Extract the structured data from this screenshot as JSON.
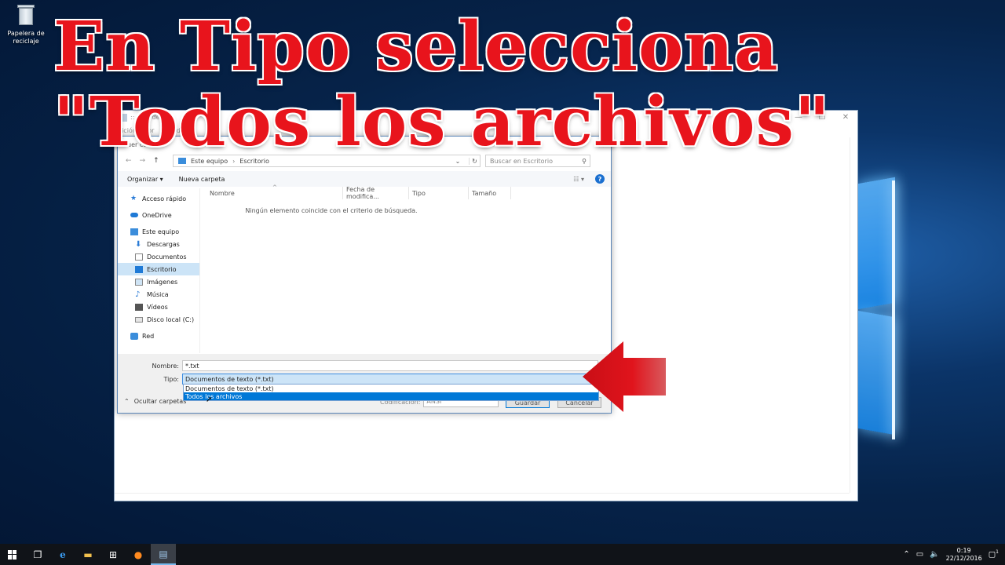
{
  "desktop": {
    "recycle_bin_label": "Papelera de reciclaje"
  },
  "caption": {
    "text": "En Tipo selecciona \"Todos los archivos\""
  },
  "notepad": {
    "title": ":: Bloc de",
    "menu": [
      "uición",
      "For",
      "er",
      "da"
    ],
    "minimize": "—",
    "maximize": "☐",
    "close": "✕"
  },
  "dialog": {
    "title": "uer como",
    "close": "✕",
    "address": {
      "root": "Este equipo",
      "current": "Escritorio"
    },
    "search_placeholder": "Buscar en Escritorio",
    "toolbar": {
      "organize": "Organizar ▾",
      "new_folder": "Nueva carpeta",
      "view": "☷ ▾",
      "help": "?"
    },
    "nav": [
      {
        "label": "Acceso rápido",
        "icon": "star-icon",
        "sub": false
      },
      {
        "label": "OneDrive",
        "icon": "cloud-icon",
        "sub": false
      },
      {
        "label": "Este equipo",
        "icon": "computer-icon",
        "sub": false
      },
      {
        "label": "Descargas",
        "icon": "download-icon",
        "sub": true
      },
      {
        "label": "Documentos",
        "icon": "document-icon",
        "sub": true
      },
      {
        "label": "Escritorio",
        "icon": "desktop-icon",
        "sub": true,
        "selected": true
      },
      {
        "label": "Imágenes",
        "icon": "image-icon",
        "sub": true
      },
      {
        "label": "Música",
        "icon": "music-icon",
        "sub": true
      },
      {
        "label": "Vídeos",
        "icon": "video-icon",
        "sub": true
      },
      {
        "label": "Disco local (C:)",
        "icon": "disk-icon",
        "sub": true
      },
      {
        "label": "Red",
        "icon": "network-icon",
        "sub": false
      }
    ],
    "columns": [
      "Nombre",
      "Fecha de modifica...",
      "Tipo",
      "Tamaño"
    ],
    "empty_message": "Ningún elemento coincide con el criterio de búsqueda.",
    "name_label": "Nombre:",
    "name_value": "*.txt",
    "type_label": "Tipo:",
    "type_value": "Documentos de texto (*.txt)",
    "type_options": [
      "Documentos de texto (*.txt)",
      "Todos los archivos"
    ],
    "hide_folders": "Ocultar carpetas",
    "encoding_label": "Codificación:",
    "encoding_value": "ANSI",
    "save_button": "Guardar",
    "cancel_button": "Cancelar"
  },
  "taskbar": {
    "time": "0:19",
    "date": "22/12/2016",
    "notification_count": "1"
  },
  "colors": {
    "caption_red": "#e8141c",
    "selection_blue": "#0078d7",
    "arrow_red": "#e0141c"
  }
}
